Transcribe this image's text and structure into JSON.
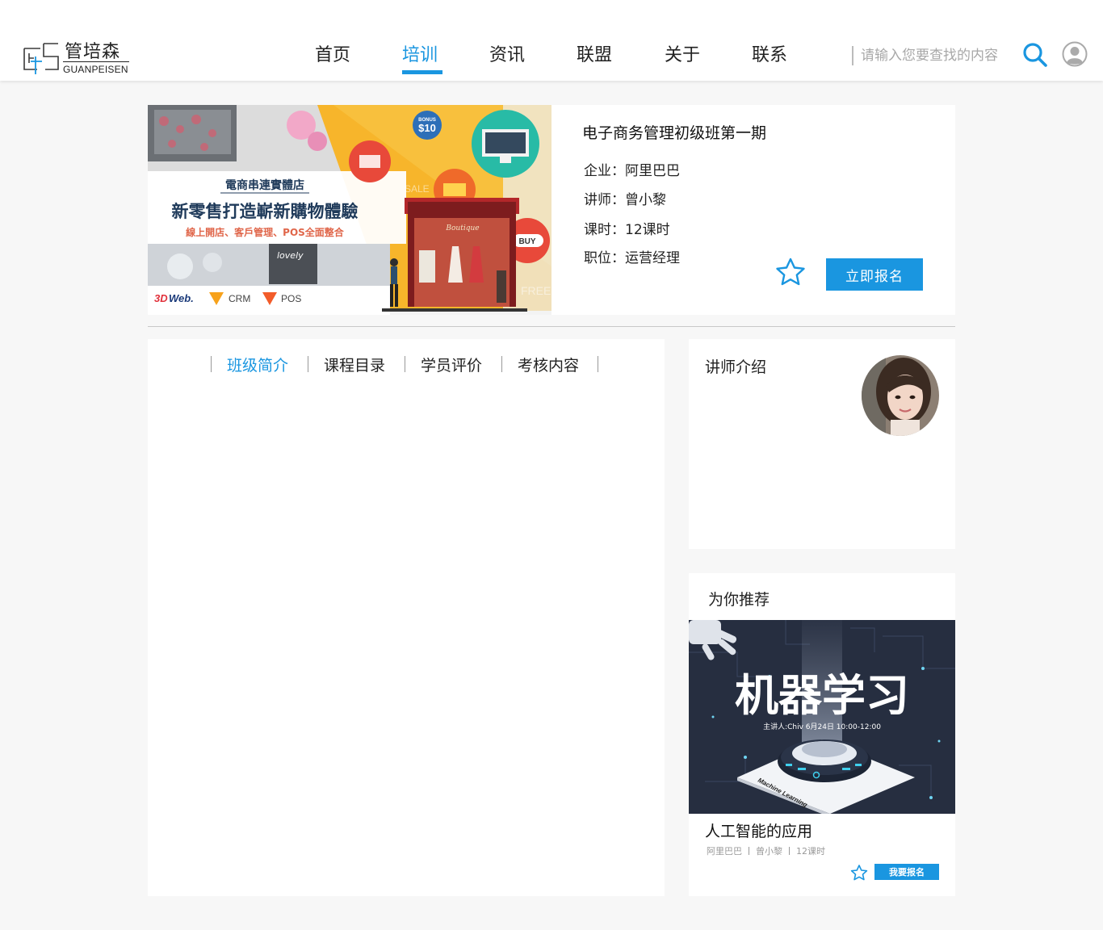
{
  "brand": {
    "name_cn": "管培森",
    "name_en": "GUANPEISEN"
  },
  "nav": {
    "items": [
      {
        "label": "首页"
      },
      {
        "label": "培训",
        "active": true
      },
      {
        "label": "资讯"
      },
      {
        "label": "联盟"
      },
      {
        "label": "关于"
      },
      {
        "label": "联系"
      }
    ]
  },
  "search": {
    "placeholder": "请输入您要查找的内容",
    "icon": "search-icon"
  },
  "user": {
    "icon": "user-icon"
  },
  "colors": {
    "accent": "#1a96e0",
    "background": "#f7f7f7"
  },
  "course": {
    "title": "电子商务管理初级班第一期",
    "company_label": "企业：",
    "company": "阿里巴巴",
    "teacher_label": "讲师：",
    "teacher": "曾小黎",
    "hours_label": "课时：",
    "hours": "12课时",
    "position_label": "职位：",
    "position": "运营经理",
    "enroll_label": "立即报名",
    "banner": {
      "heading": "電商串連實體店",
      "main": "新零售打造嶄新購物體驗",
      "sub": "線上開店、客戶管理、POS全面整合",
      "bonus_top": "BONUS",
      "bonus_value": "$10",
      "sale": "SALE",
      "buy": "BUY",
      "boutique": "Boutique",
      "free": "FREE",
      "logo1": "Web.",
      "logo2": "CRM",
      "logo3": "POS"
    }
  },
  "tabs": [
    {
      "label": "班级简介",
      "active": true
    },
    {
      "label": "课程目录"
    },
    {
      "label": "学员评价"
    },
    {
      "label": "考核内容"
    }
  ],
  "teacher_section": {
    "title": "讲师介绍"
  },
  "recommend": {
    "title": "为你推荐",
    "image": {
      "heading": "机器学习",
      "subtitle": "主讲人:Chiv  6月24日 10:00-12:00",
      "tag": "Machine Learning"
    },
    "course_title": "人工智能的应用",
    "company": "阿里巴巴",
    "teacher": "曾小黎",
    "hours": "12课时",
    "enroll_label": "我要报名"
  }
}
